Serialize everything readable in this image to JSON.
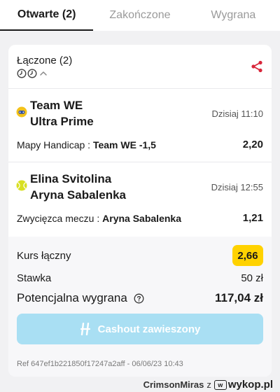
{
  "tabs": [
    {
      "label": "Otwarte (2)",
      "active": true
    },
    {
      "label": "Zakończone",
      "active": false
    },
    {
      "label": "Wygrana",
      "active": false
    }
  ],
  "bet": {
    "type_label": "Łączone (2)",
    "icons": [
      "clock-icon",
      "clock-icon",
      "chevron-up-icon",
      "share-icon"
    ]
  },
  "events": [
    {
      "sport_icon": "esports-icon",
      "team1": "Team WE",
      "team2": "Ultra Prime",
      "time": "Dzisiaj 11:10",
      "market": "Mapy Handicap :",
      "selection": "Team WE -1,5",
      "odd": "2,20"
    },
    {
      "sport_icon": "tennis-ball-icon",
      "team1": "Elina Svitolina",
      "team2": "Aryna Sabalenka",
      "time": "Dzisiaj 12:55",
      "market": "Zwycięzca meczu :",
      "selection": "Aryna Sabalenka",
      "odd": "1,21"
    }
  ],
  "summary": {
    "kurs_label": "Kurs łączny",
    "kurs_value": "2,66",
    "stawka_label": "Stawka",
    "stawka_value": "50 zł",
    "wygrana_label": "Potencjalna wygrana",
    "wygrana_value": "117,04 zł",
    "cashout_label": "Cashout zawieszony",
    "ref": "Ref 647ef1b221850f17247a2aff - 06/06/23 10:43"
  },
  "footer": {
    "user": "CrimsonMiras",
    "z": "z",
    "logo_box": "w",
    "logo_text": "wykop.pl"
  },
  "colors": {
    "accent_yellow": "#ffd200",
    "share_red": "#d8263a",
    "cashout_disabled": "#a9dff3"
  }
}
